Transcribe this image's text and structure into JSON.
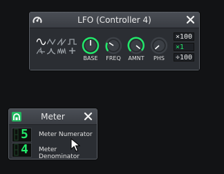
{
  "lfo": {
    "title": "LFO (Controller 4)",
    "knobs": [
      {
        "label": "BASE"
      },
      {
        "label": "FREQ"
      },
      {
        "label": "AMNT"
      },
      {
        "label": "PHS"
      }
    ],
    "multipliers": [
      {
        "label": "×100"
      },
      {
        "label": "×1"
      },
      {
        "label": "÷100"
      }
    ],
    "waveforms": [
      "sine",
      "triangle",
      "saw",
      "square",
      "moog",
      "exponential",
      "white-noise",
      "user-defined"
    ],
    "selected_waveform": "sine",
    "selected_multiplier": "×1",
    "accent": "#22e86a"
  },
  "meter": {
    "title": "Meter",
    "numerator": {
      "value": "5",
      "label": "Meter Numerator"
    },
    "denominator": {
      "value": "4",
      "label": "Meter Denominator"
    }
  }
}
